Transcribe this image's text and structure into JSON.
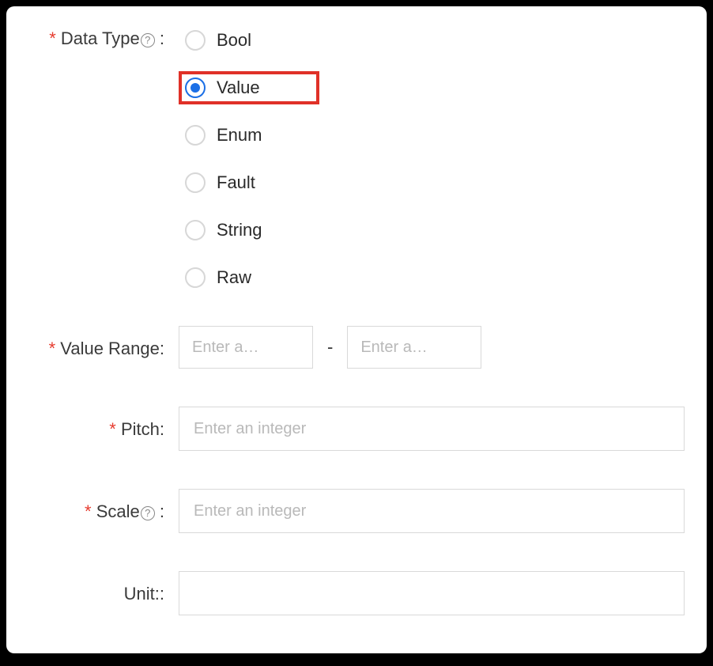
{
  "data_type": {
    "label": "Data Type",
    "options": {
      "bool": "Bool",
      "value": "Value",
      "enum": "Enum",
      "fault": "Fault",
      "string": "String",
      "raw": "Raw"
    },
    "selected": "value",
    "help_glyph": "?"
  },
  "value_range": {
    "label": "Value Range:",
    "min_placeholder": "Enter a…",
    "max_placeholder": "Enter a…",
    "separator": "-"
  },
  "pitch": {
    "label": "Pitch:",
    "placeholder": "Enter an integer"
  },
  "scale": {
    "label": "Scale",
    "help_glyph": "?",
    "placeholder": "Enter an integer"
  },
  "unit": {
    "label": "Unit::"
  }
}
